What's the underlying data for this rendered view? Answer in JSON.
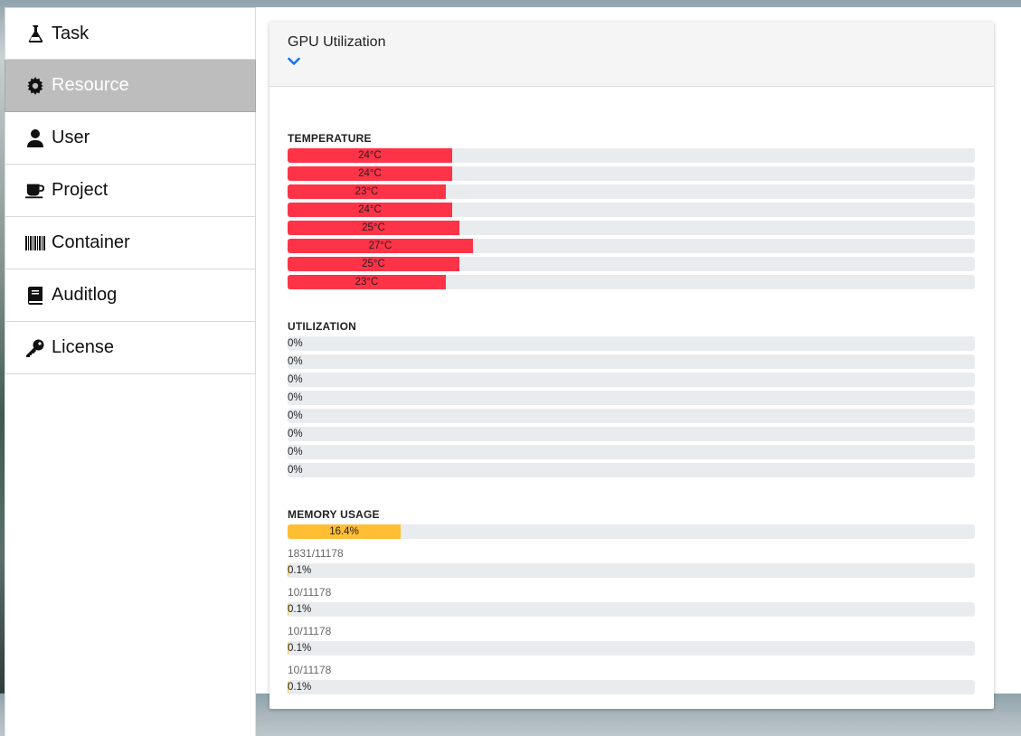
{
  "sidebar": {
    "items": [
      {
        "label": "Task",
        "icon": "flask-icon"
      },
      {
        "label": "Resource",
        "icon": "gear-icon",
        "active": true
      },
      {
        "label": "User",
        "icon": "user-icon"
      },
      {
        "label": "Project",
        "icon": "coffee-cup-icon"
      },
      {
        "label": "Container",
        "icon": "barcode-icon"
      },
      {
        "label": "Auditlog",
        "icon": "book-icon"
      },
      {
        "label": "License",
        "icon": "key-icon"
      }
    ]
  },
  "panel": {
    "title": "GPU Utilization",
    "toggle_icon": "chevron-down-icon"
  },
  "colors": {
    "temperature": "#ff3347",
    "memory": "#ffbe33",
    "track": "#e9ecef",
    "accent": "#1a73e8"
  },
  "temperature": {
    "title": "TEMPERATURE",
    "rows": [
      {
        "label": "24°C",
        "fraction": 0.24
      },
      {
        "label": "24°C",
        "fraction": 0.24
      },
      {
        "label": "23°C",
        "fraction": 0.23
      },
      {
        "label": "24°C",
        "fraction": 0.24
      },
      {
        "label": "25°C",
        "fraction": 0.25
      },
      {
        "label": "27°C",
        "fraction": 0.27
      },
      {
        "label": "25°C",
        "fraction": 0.25
      },
      {
        "label": "23°C",
        "fraction": 0.23
      }
    ]
  },
  "utilization": {
    "title": "UTILIZATION",
    "rows": [
      {
        "label": "0%",
        "fraction": 0
      },
      {
        "label": "0%",
        "fraction": 0
      },
      {
        "label": "0%",
        "fraction": 0
      },
      {
        "label": "0%",
        "fraction": 0
      },
      {
        "label": "0%",
        "fraction": 0
      },
      {
        "label": "0%",
        "fraction": 0
      },
      {
        "label": "0%",
        "fraction": 0
      },
      {
        "label": "0%",
        "fraction": 0
      }
    ]
  },
  "memory": {
    "title": "MEMORY USAGE",
    "rows": [
      {
        "label": "16.4%",
        "fraction": 0.164,
        "text": "1831/11178"
      },
      {
        "label": "0.1%",
        "fraction": 0.001,
        "text": "10/11178"
      },
      {
        "label": "0.1%",
        "fraction": 0.001,
        "text": "10/11178"
      },
      {
        "label": "0.1%",
        "fraction": 0.001,
        "text": "10/11178"
      },
      {
        "label": "0.1%",
        "fraction": 0.001,
        "text": ""
      }
    ]
  }
}
